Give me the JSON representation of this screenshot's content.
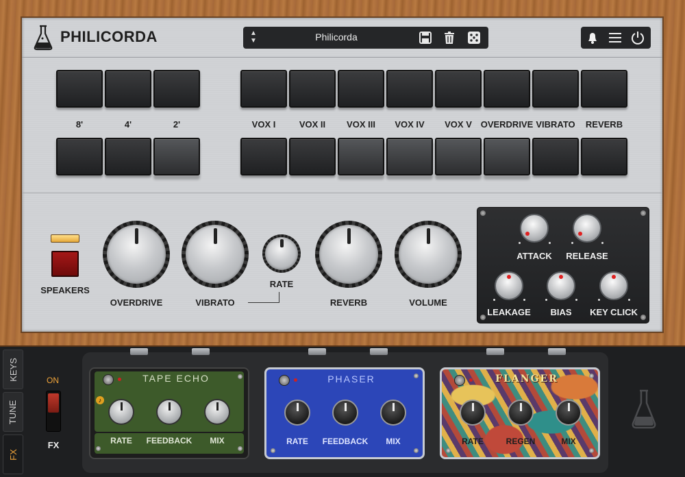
{
  "header": {
    "title": "PHILICORDA",
    "preset_name": "Philicorda"
  },
  "footages": [
    "8'",
    "4'",
    "2'"
  ],
  "voices": [
    "VOX I",
    "VOX II",
    "VOX III",
    "VOX IV",
    "VOX V",
    "OVERDRIVE",
    "VIBRATO",
    "REVERB"
  ],
  "knobs": {
    "speakers": "SPEAKERS",
    "overdrive": "OVERDRIVE",
    "vibrato": "VIBRATO",
    "rate": "RATE",
    "reverb": "REVERB",
    "volume": "VOLUME"
  },
  "envelope": {
    "attack": "ATTACK",
    "release": "RELEASE",
    "leakage": "LEAKAGE",
    "bias": "BIAS",
    "key_click": "KEY CLICK"
  },
  "tabs": [
    "KEYS",
    "TUNE",
    "FX"
  ],
  "fx": {
    "on_label": "ON",
    "label": "FX"
  },
  "pedals": {
    "tape_echo": {
      "title": "TAPE ECHO",
      "knobs": [
        "RATE",
        "FEEDBACK",
        "MIX"
      ]
    },
    "phaser": {
      "title": "PHASER",
      "knobs": [
        "RATE",
        "FEEDBACK",
        "MIX"
      ]
    },
    "flanger": {
      "title": "FLANGER",
      "knobs": [
        "RATE",
        "REGEN",
        "MIX"
      ]
    }
  },
  "colors": {
    "accent": "#f0a43a",
    "tape_echo": "#3d5a2a",
    "phaser": "#2c46b8",
    "wood": "#a86b37"
  }
}
